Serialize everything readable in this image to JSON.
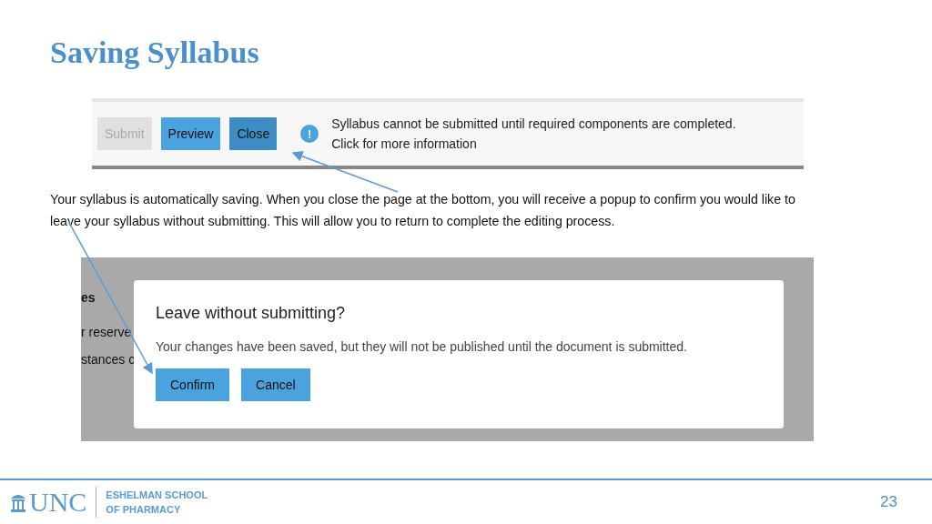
{
  "slide": {
    "title": "Saving Syllabus",
    "number": "23"
  },
  "screenshot_toolbar": {
    "buttons": [
      {
        "label": "Submit",
        "disabled": true,
        "kind": "plain"
      },
      {
        "label": "Preview",
        "disabled": false,
        "kind": "light"
      },
      {
        "label": "Close",
        "disabled": false,
        "kind": "dark"
      }
    ],
    "notice": {
      "icon": "!",
      "lines": [
        "Syllabus cannot be submitted until required components are completed.",
        "Click for more information"
      ]
    }
  },
  "paragraph": "Your syllabus is automatically saving.  When you close the page at the bottom, you will receive a popup to confirm you would like to leave your syllabus without submitting.  This will allow you to return to complete the editing process.",
  "screenshot_dialog": {
    "background_texts": [
      {
        "text": "es",
        "kind": "heading"
      },
      {
        "text": "r reserve",
        "kind": "line"
      },
      {
        "text": "stances c",
        "kind": "line"
      }
    ],
    "dialog": {
      "title": "Leave without submitting?",
      "message": "Your changes have been saved, but they will not be published until the document is submitted.",
      "buttons": [
        {
          "label": "Confirm"
        },
        {
          "label": "Cancel"
        }
      ]
    }
  },
  "footer": {
    "logo_text": "UNC",
    "school_lines": [
      "ESHELMAN SCHOOL",
      "OF PHARMACY"
    ]
  }
}
